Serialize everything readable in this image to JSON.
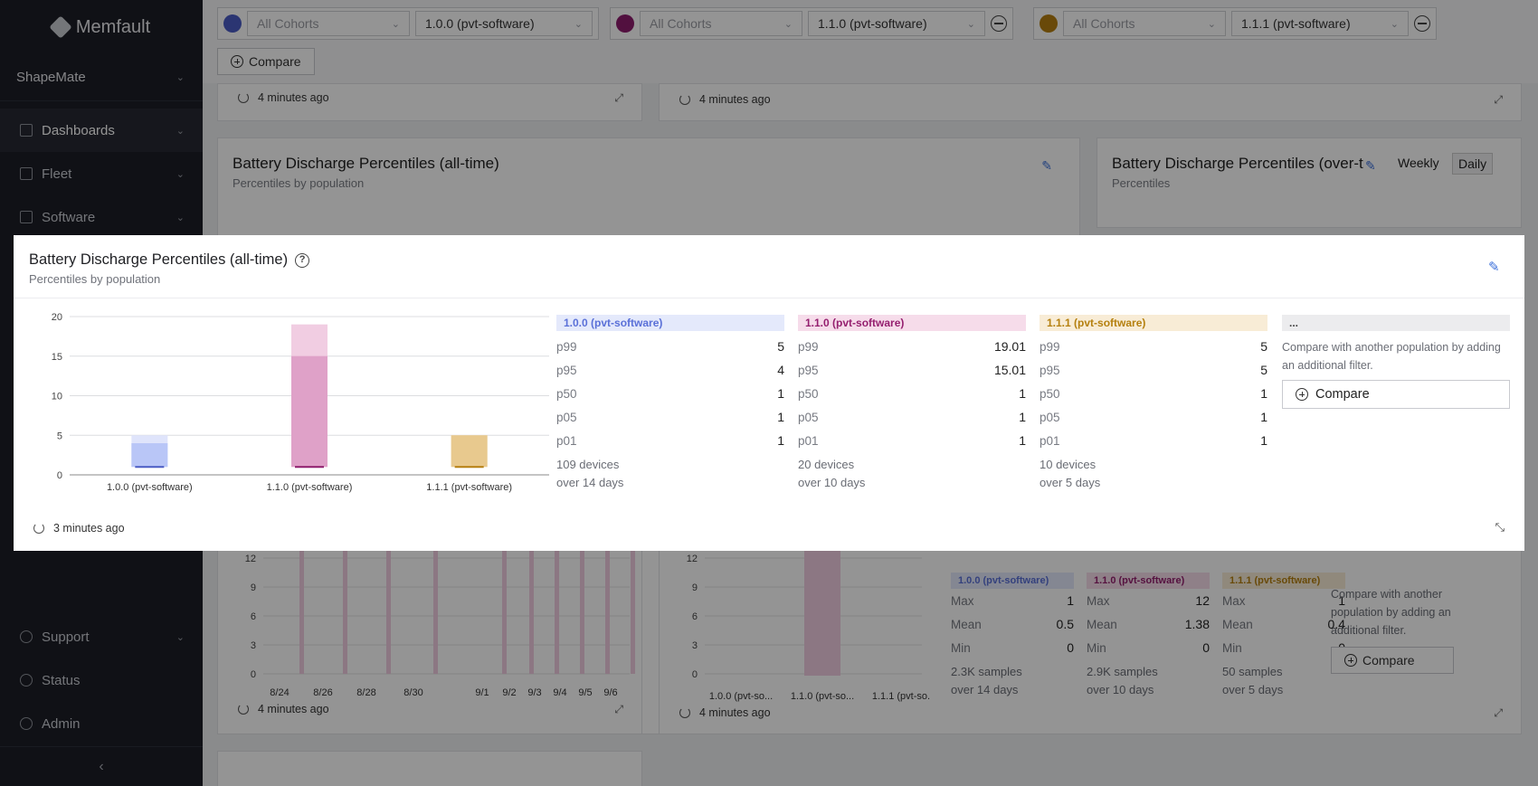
{
  "app": {
    "name": "Memfault",
    "project": "ShapeMate"
  },
  "sidebar": {
    "items": [
      {
        "label": "Dashboards"
      },
      {
        "label": "Fleet"
      },
      {
        "label": "Software"
      }
    ],
    "bottom_items": [
      {
        "label": "Support"
      },
      {
        "label": "Status"
      },
      {
        "label": "Admin"
      }
    ]
  },
  "filters": [
    {
      "cohort": "All Cohorts",
      "version": "1.0.0 (pvt-software)",
      "color": "#4a5cc4"
    },
    {
      "cohort": "All Cohorts",
      "version": "1.1.0 (pvt-software)",
      "color": "#8e1d6d"
    },
    {
      "cohort": "All Cohorts",
      "version": "1.1.1 (pvt-software)",
      "color": "#b57f10"
    }
  ],
  "compare_label": "Compare",
  "background": {
    "ts_top_left": "4 minutes ago",
    "ts_top_right": "4 minutes ago",
    "card_left_title": "Battery Discharge Percentiles (all-time)",
    "card_left_sub": "Percentiles by population",
    "card_right_title": "Battery Discharge Percentiles (over-t",
    "card_right_sub": "Percentiles",
    "toggle_weekly": "Weekly",
    "toggle_daily": "Daily",
    "ts_bottom_left": "4 minutes ago",
    "ts_bottom_right": "4 minutes ago",
    "stats": [
      {
        "tag": "1.0.0 (pvt-software)",
        "max": "1",
        "mean": "0.5",
        "min": "0",
        "samples": "2.3K samples",
        "over": "over 14 days"
      },
      {
        "tag": "1.1.0 (pvt-software)",
        "max": "12",
        "mean": "1.38",
        "min": "0",
        "samples": "2.9K samples",
        "over": "over 10 days"
      },
      {
        "tag": "1.1.1 (pvt-software)",
        "max": "1",
        "mean": "0.4",
        "min": "0",
        "samples": "50 samples",
        "over": "over 5 days"
      }
    ],
    "stat_labels": {
      "max": "Max",
      "mean": "Mean",
      "min": "Min"
    },
    "compare_note": "Compare with another population by adding an additional filter.",
    "date_ticks": [
      "8/24",
      "8/26",
      "8/28",
      "8/30",
      "9/1",
      "9/2",
      "9/3",
      "9/4",
      "9/5",
      "9/6"
    ],
    "y_ticks_small": [
      "12",
      "9",
      "6",
      "3",
      "0"
    ],
    "small_cats": [
      "1.0.0 (pvt-so...",
      "1.1.0 (pvt-so...",
      "1.1.1 (pvt-so..."
    ]
  },
  "modal": {
    "title": "Battery Discharge Percentiles (all-time)",
    "subtitle": "Percentiles by population",
    "timestamp": "3 minutes ago",
    "compare_note": "Compare with another population by adding an additional filter.",
    "compare_label": "Compare",
    "more_tag": "...",
    "populations": [
      {
        "tag": "1.0.0 (pvt-software)",
        "tag_bg": "#e4e9fb",
        "tag_fg": "#5a70d8",
        "rows": [
          {
            "k": "p99",
            "v": "5"
          },
          {
            "k": "p95",
            "v": "4"
          },
          {
            "k": "p50",
            "v": "1"
          },
          {
            "k": "p05",
            "v": "1"
          },
          {
            "k": "p01",
            "v": "1"
          }
        ],
        "devices": "109 devices",
        "span": "over 14 days"
      },
      {
        "tag": "1.1.0 (pvt-software)",
        "tag_bg": "#f6dcea",
        "tag_fg": "#951f6f",
        "rows": [
          {
            "k": "p99",
            "v": "19.01"
          },
          {
            "k": "p95",
            "v": "15.01"
          },
          {
            "k": "p50",
            "v": "1"
          },
          {
            "k": "p05",
            "v": "1"
          },
          {
            "k": "p01",
            "v": "1"
          }
        ],
        "devices": "20 devices",
        "span": "over 10 days"
      },
      {
        "tag": "1.1.1 (pvt-software)",
        "tag_bg": "#f8ecd6",
        "tag_fg": "#b5800f",
        "rows": [
          {
            "k": "p99",
            "v": "5"
          },
          {
            "k": "p95",
            "v": "5"
          },
          {
            "k": "p50",
            "v": "1"
          },
          {
            "k": "p05",
            "v": "1"
          },
          {
            "k": "p01",
            "v": "1"
          }
        ],
        "devices": "10 devices",
        "span": "over 5 days"
      }
    ]
  },
  "chart_data": {
    "type": "bar",
    "categories": [
      "1.0.0 (pvt-software)",
      "1.1.0 (pvt-software)",
      "1.1.1 (pvt-software)"
    ],
    "y_ticks": [
      0,
      5,
      10,
      15,
      20
    ],
    "ylim": [
      0,
      20
    ],
    "series": [
      {
        "p01": 1,
        "p05": 1,
        "p50": 1,
        "p95": 4,
        "p99": 5,
        "color_light": "#dfe4fb",
        "color_mid": "#b9c6f7",
        "color_line": "#4a5cc4"
      },
      {
        "p01": 1,
        "p05": 1,
        "p50": 1,
        "p95": 15.01,
        "p99": 19.01,
        "color_light": "#f1cde2",
        "color_mid": "#dfa1c8",
        "color_line": "#8e1d6d"
      },
      {
        "p01": 1,
        "p05": 1,
        "p50": 1,
        "p95": 5,
        "p99": 5,
        "color_light": "#f4e3c2",
        "color_mid": "#e8c98e",
        "color_line": "#b57f10"
      }
    ]
  }
}
